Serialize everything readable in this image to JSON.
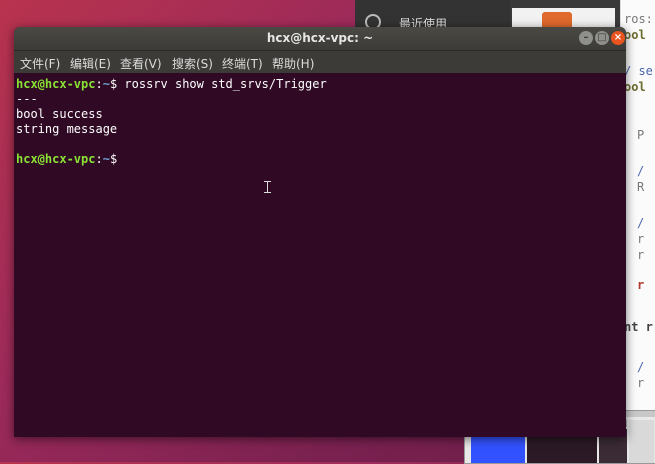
{
  "background_files": {
    "recent_label": "最近使用",
    "icons": [
      "clock-icon",
      "document-icon"
    ]
  },
  "background_editor": {
    "lines": [
      "ros:",
      "ool",
      "/ se",
      "ool",
      "P",
      "/",
      "R",
      "/",
      "r",
      "r",
      "r",
      "nt r",
      "/",
      "r"
    ]
  },
  "terminal": {
    "title": "hcx@hcx-vpc: ~",
    "window_buttons": {
      "minimize": "–",
      "maximize": "□",
      "close": "×"
    },
    "menu": [
      "文件(F)",
      "编辑(E)",
      "查看(V)",
      "搜索(S)",
      "终端(T)",
      "帮助(H)"
    ],
    "lines": [
      {
        "user": "hcx@hcx-vpc",
        "sep": ":",
        "path": "~",
        "dollar": "$ ",
        "cmd": "rossrv show std_srvs/Trigger"
      },
      {
        "text": "---"
      },
      {
        "text": "bool success"
      },
      {
        "text": "string message"
      },
      {
        "text": ""
      },
      {
        "user": "hcx@hcx-vpc",
        "sep": ":",
        "path": "~",
        "dollar": "$ ",
        "cmd": ""
      }
    ]
  },
  "colors": {
    "terminal_bg": "#300a24",
    "prompt_user": "#8ae234",
    "prompt_path": "#729fcf",
    "close_button": "#e95420"
  }
}
